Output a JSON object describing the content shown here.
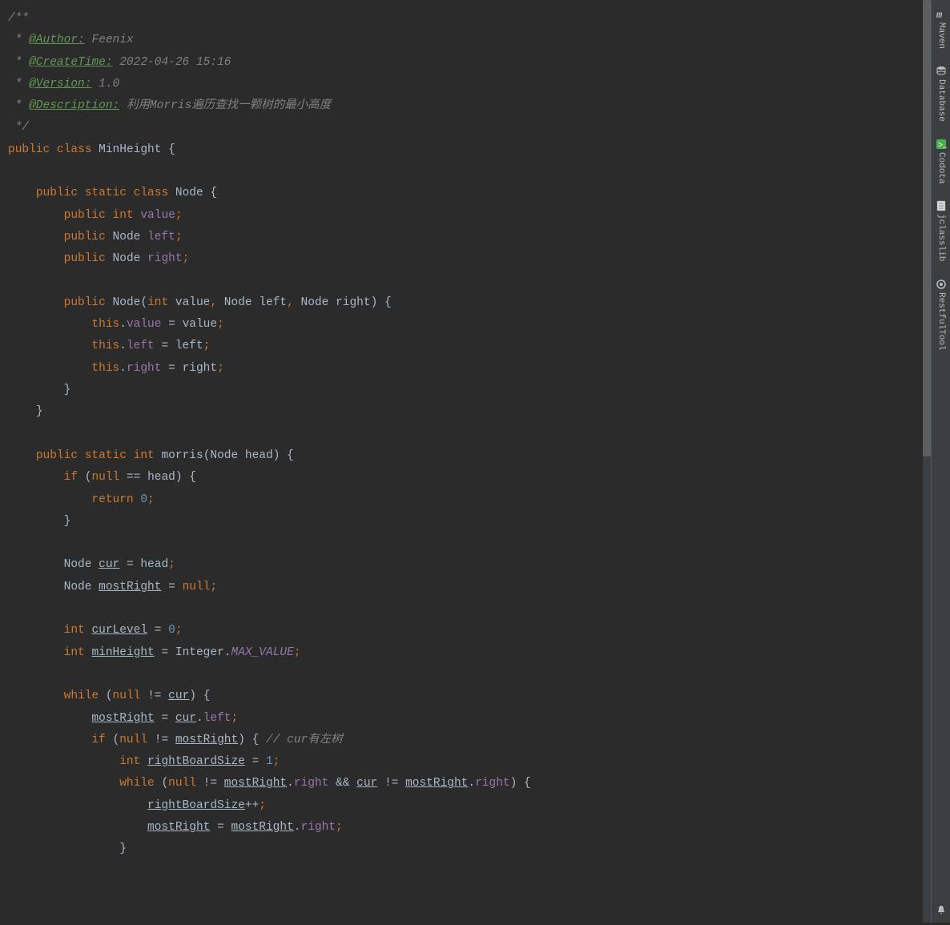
{
  "code": {
    "comment_start": "/**",
    "author_tag": "@Author:",
    "author_val": "Feenix",
    "createtime_tag": "@CreateTime:",
    "createtime_val": "2022-04-26 15:16",
    "version_tag": "@Version:",
    "version_val": "1.0",
    "description_tag": "@Description:",
    "description_val": "利用Morris遍历查找一颗树的最小高度",
    "comment_end": "*/",
    "kw_public": "public",
    "kw_static": "static",
    "kw_class": "class",
    "kw_int": "int",
    "kw_this": "this",
    "kw_return": "return",
    "kw_if": "if",
    "kw_while": "while",
    "kw_null": "null",
    "class_minheight": "MinHeight",
    "class_node": "Node",
    "field_value": "value",
    "field_left": "left",
    "field_right": "right",
    "method_morris": "morris",
    "param_head": "head",
    "var_cur": "cur",
    "var_mostRight": "mostRight",
    "var_curLevel": "curLevel",
    "var_minHeight": "minHeight",
    "var_rightBoardSize": "rightBoardSize",
    "class_integer": "Integer",
    "const_maxvalue": "MAX_VALUE",
    "num_0": "0",
    "num_1": "1",
    "comment_cur_left": "// cur有左树",
    "star": "*"
  },
  "tools": {
    "maven": "Maven",
    "database": "Database",
    "codota": "Codota",
    "jclasslib": "jclasslib",
    "restfultool": "RestfulTool"
  }
}
